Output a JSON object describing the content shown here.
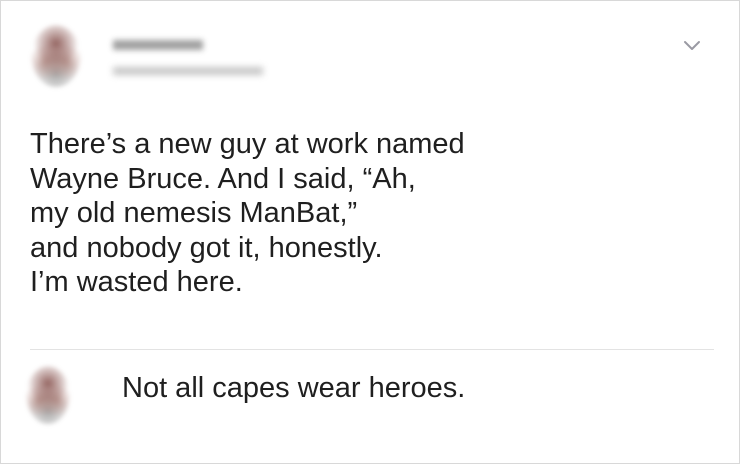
{
  "tweet": {
    "text_lines": [
      "There’s a new guy at work named",
      "Wayne Bruce. And I said, “Ah,",
      "my old nemesis ManBat,”",
      "and nobody got it, honestly.",
      "I’m wasted here."
    ]
  },
  "reply": {
    "text": "Not all capes wear heroes."
  },
  "icons": {
    "menu": "chevron-down-icon"
  },
  "colors": {
    "text": "#1f1f1f",
    "border": "#d8d8d8",
    "divider": "#e3e3e3",
    "chevron": "#9a9aa3"
  }
}
